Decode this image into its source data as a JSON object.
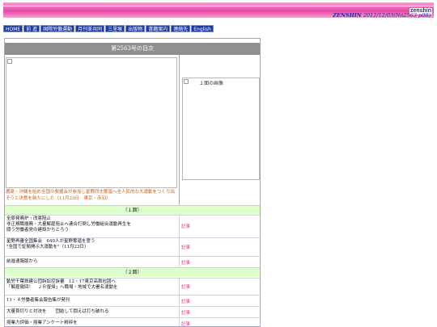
{
  "header": {
    "logo_text": "zenshin",
    "edition_prefix": "ZENSHIN",
    "edition_text": "2012/12/03(No2563 p08)"
  },
  "nav": [
    "HOME",
    "前 進",
    "国際労働運動",
    "月刊革共同",
    "三里塚",
    "出版物",
    "書籍案内",
    "連絡先",
    "English"
  ],
  "toc": {
    "title": "第2563号の目次",
    "feature_caption": "農島・沖縄を始め全国の救援会が参加し星野同志奪還へ全人民的な大運動をつくり出そうと決意を新たにした（11月23日　東京・赤羽）",
    "page1_image_alt": "１面の画像",
    "link_label": "記事"
  },
  "sections": [
    {
      "label": "（１面）",
      "items": [
        {
          "title": "全原発廃炉・改憲阻止\n非正規職撤廃・大量解雇阻止へ連合打倒し労働組合運動再生を\n闘う労働者党の建設かちとろう"
        },
        {
          "title": "星野再審全国集会　640人が星野奪還を誓う\n\"全国で証拠開示大運動を\"（11月23日）"
        },
        {
          "title": "前進速報版から"
        }
      ]
    },
    {
      "label": "（２面）",
      "items": [
        {
          "title": "動労千葉鉄建公団訴訟控訴審　12・17東京高裁包囲へ\n「解雇撤回！　ＪＲ復帰」へ職場・地域で大署名運動を"
        },
        {
          "title": "11・４労働者集会報告集が発刊"
        },
        {
          "title": "大量首切りと対決を　　団結して闘えば打ち破れる"
        },
        {
          "title": "授業力評価・授業アンケート粉砕を"
        }
      ]
    }
  ]
}
